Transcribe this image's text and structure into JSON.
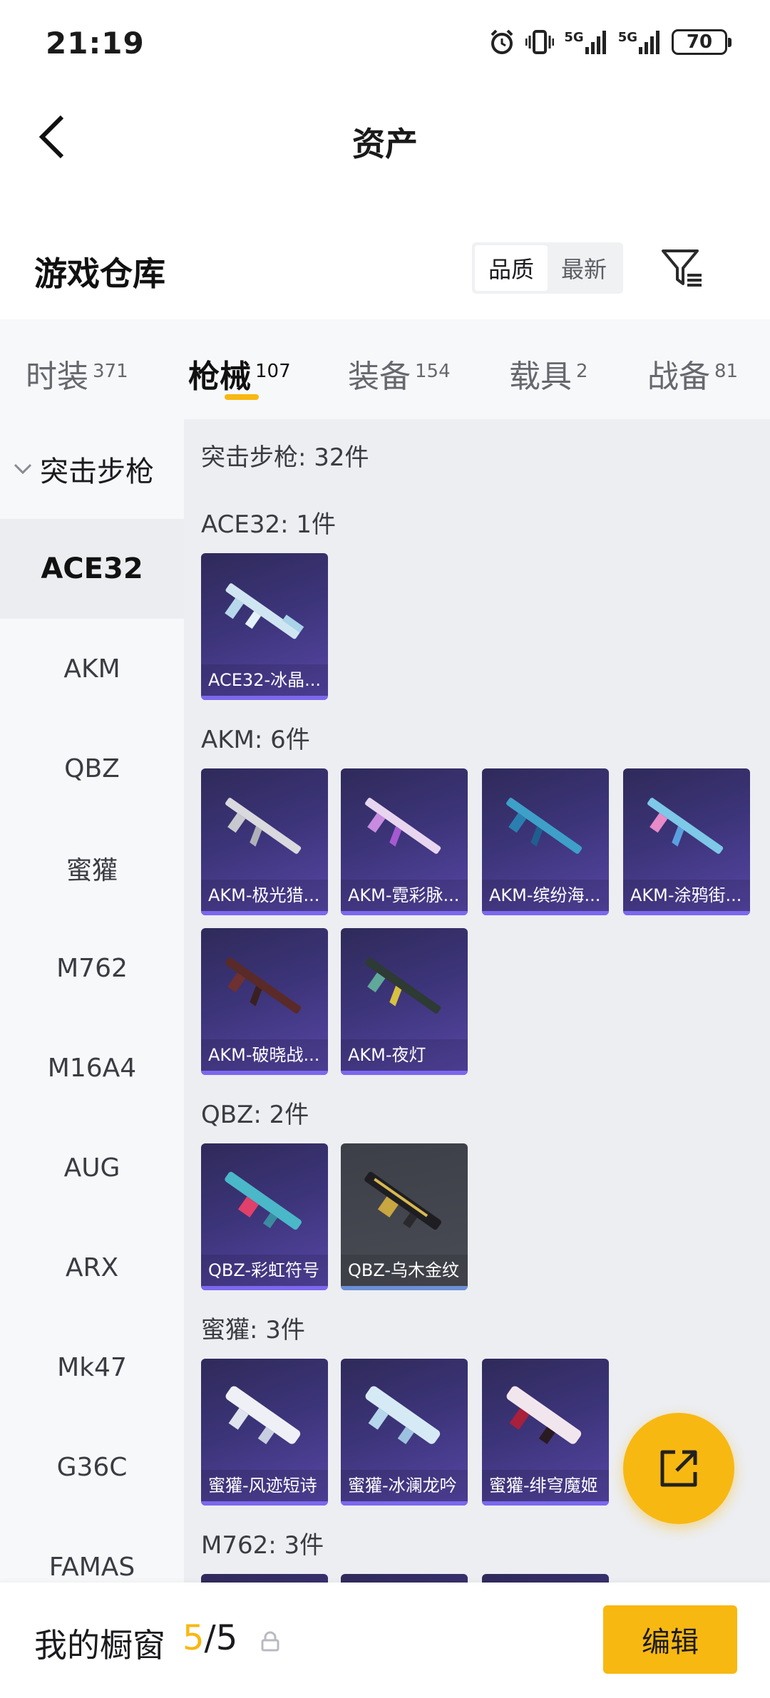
{
  "status_bar": {
    "time": "21:19",
    "signal_1": "5G",
    "signal_2": "5G",
    "battery": "70"
  },
  "header": {
    "title": "资产"
  },
  "warehouse": {
    "title": "游戏仓库",
    "sort_options": [
      "品质",
      "最新"
    ],
    "sort_selected": "品质"
  },
  "tabs": [
    {
      "label": "时装",
      "count": "371"
    },
    {
      "label": "枪械",
      "count": "107",
      "active": true
    },
    {
      "label": "装备",
      "count": "154"
    },
    {
      "label": "载具",
      "count": "2"
    },
    {
      "label": "战备",
      "count": "81"
    }
  ],
  "sidenav": {
    "group": "突击步枪",
    "items": [
      "ACE32",
      "AKM",
      "QBZ",
      "蜜獾",
      "M762",
      "M16A4",
      "AUG",
      "ARX",
      "Mk47",
      "G36C",
      "FAMAS"
    ],
    "active": "ACE32"
  },
  "content": {
    "category_title": "突击步枪: 32件",
    "sections": [
      {
        "title": "ACE32: 1件",
        "items": [
          "ACE32-冰晶..."
        ]
      },
      {
        "title": "AKM: 6件",
        "items": [
          "AKM-极光猎...",
          "AKM-霓彩脉...",
          "AKM-缤纷海...",
          "AKM-涂鸦街...",
          "AKM-破晓战...",
          "AKM-夜灯"
        ]
      },
      {
        "title": "QBZ: 2件",
        "items": [
          "QBZ-彩虹符号",
          "QBZ-乌木金纹"
        ]
      },
      {
        "title": "蜜獾: 3件",
        "items": [
          "蜜獾-风迹短诗",
          "蜜獾-冰澜龙吟",
          "蜜獾-绯穹魔姬"
        ]
      },
      {
        "title": "M762: 3件",
        "items": []
      }
    ]
  },
  "bottom_bar": {
    "label": "我的橱窗",
    "current": "5",
    "separator": "/",
    "total": "5",
    "edit_label": "编辑"
  },
  "colors": {
    "accent": "#f8b812",
    "card_purple": "#3c3479",
    "card_gray": "#4a4c55"
  }
}
